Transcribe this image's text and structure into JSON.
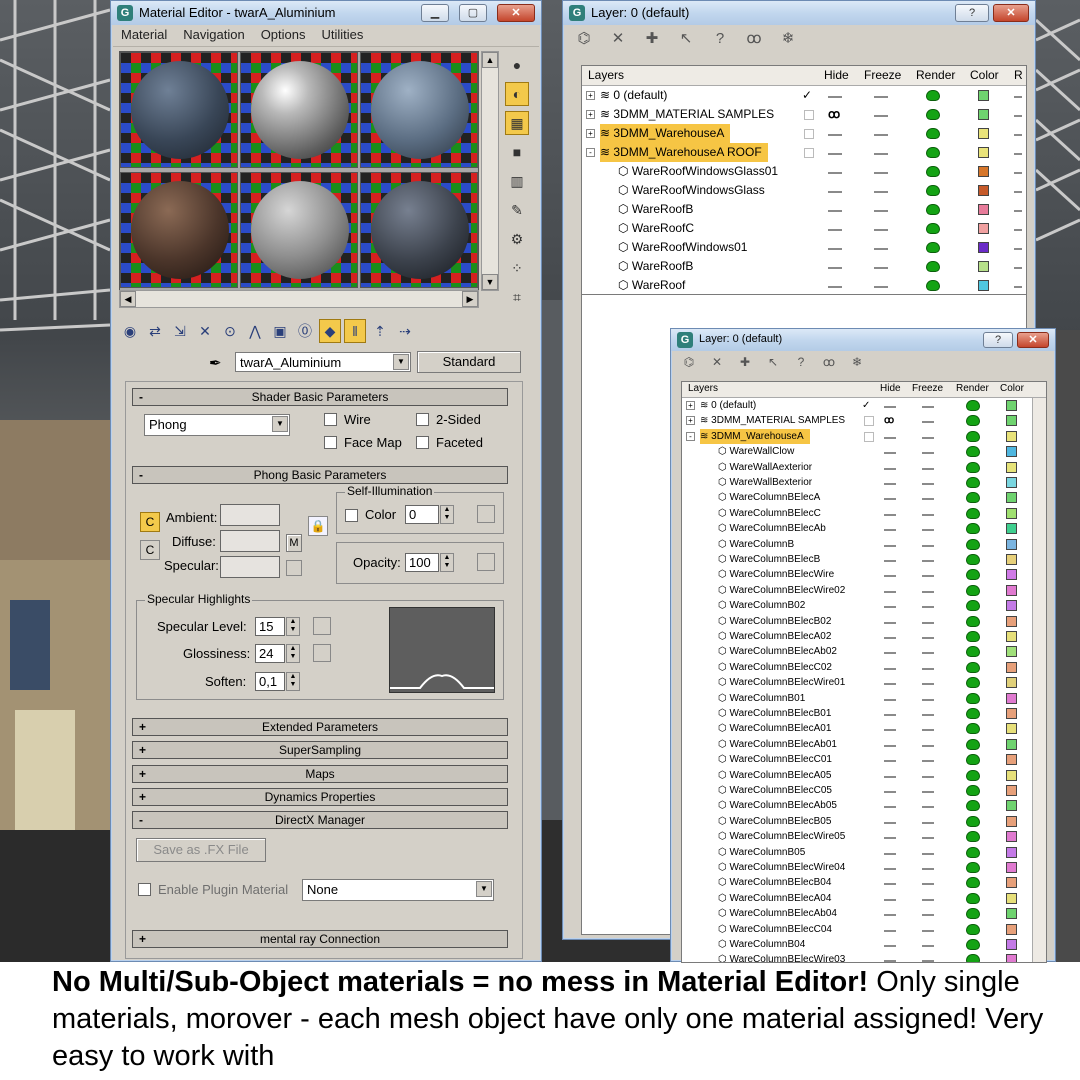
{
  "material_editor": {
    "title": "Material Editor - twarA_Aluminium",
    "menu": [
      "Material",
      "Navigation",
      "Options",
      "Utilities"
    ],
    "material_name": "twarA_Aluminium",
    "material_type": "Standard",
    "shader_rollout": "Shader Basic Parameters",
    "shader": "Phong",
    "wire_label": "Wire",
    "two_sided_label": "2-Sided",
    "face_map_label": "Face Map",
    "faceted_label": "Faceted",
    "phong_rollout": "Phong Basic Parameters",
    "self_illumination_label": "Self-Illumination",
    "ambient_label": "Ambient:",
    "diffuse_label": "Diffuse:",
    "specular_label": "Specular:",
    "m_label": "M",
    "color_label": "Color",
    "color_value": "0",
    "opacity_label": "Opacity:",
    "opacity_value": "100",
    "specular_highlights_label": "Specular Highlights",
    "specular_level_label": "Specular Level:",
    "specular_level_value": "15",
    "glossiness_label": "Glossiness:",
    "glossiness_value": "24",
    "soften_label": "Soften:",
    "soften_value": "0,1",
    "rollouts": [
      "Extended Parameters",
      "SuperSampling",
      "Maps",
      "Dynamics Properties",
      "DirectX Manager",
      "mental ray Connection"
    ],
    "save_fx_label": "Save as .FX File",
    "enable_plugin_label": "Enable Plugin Material",
    "plugin_value": "None"
  },
  "layer_window": {
    "title": "Layer: 0 (default)",
    "columns": [
      "Layers",
      "Hide",
      "Freeze",
      "Render",
      "Color",
      "R"
    ],
    "rows": [
      {
        "name": "0 (default)",
        "level": 0,
        "expand": "+",
        "active": true,
        "hidden": false,
        "highlight": false,
        "color": "#6fd36f"
      },
      {
        "name": "3DMM_MATERIAL SAMPLES",
        "level": 0,
        "expand": "+",
        "active": false,
        "hidden": true,
        "highlight": false,
        "color": "#6fd36f"
      },
      {
        "name": "3DMM_WarehouseA",
        "level": 0,
        "expand": "+",
        "active": false,
        "hidden": false,
        "highlight": true,
        "color": "#e9e37a"
      },
      {
        "name": "3DMM_WarehouseA ROOF",
        "level": 0,
        "expand": "-",
        "active": false,
        "hidden": false,
        "highlight": true,
        "color": "#e9e37a"
      },
      {
        "name": "WareRoofWindowsGlass01",
        "level": 1,
        "color": "#d6762a"
      },
      {
        "name": "WareRoofWindowsGlass",
        "level": 1,
        "color": "#c65a2a"
      },
      {
        "name": "WareRoofB",
        "level": 1,
        "color": "#e77b9a"
      },
      {
        "name": "WareRoofC",
        "level": 1,
        "color": "#f0a0a0"
      },
      {
        "name": "WareRoofWindows01",
        "level": 1,
        "color": "#6a2bc8"
      },
      {
        "name": "WareRoofB",
        "level": 1,
        "color": "#b7e08a"
      },
      {
        "name": "WareRoof",
        "level": 1,
        "color": "#4fc7e0"
      }
    ]
  },
  "layer_window2": {
    "title": "Layer: 0 (default)",
    "columns": [
      "Layers",
      "Hide",
      "Freeze",
      "Render",
      "Color"
    ],
    "rows": [
      {
        "name": "0 (default)",
        "level": 0,
        "expand": "+",
        "active": true,
        "hidden": false,
        "highlight": false,
        "color": "#6fd36f"
      },
      {
        "name": "3DMM_MATERIAL SAMPLES",
        "level": 0,
        "expand": "+",
        "active": false,
        "hidden": true,
        "highlight": false,
        "color": "#6fd36f"
      },
      {
        "name": "3DMM_WarehouseA",
        "level": 0,
        "expand": "-",
        "active": false,
        "hidden": false,
        "highlight": true,
        "color": "#e9e37a"
      },
      {
        "name": "WareWallClow",
        "level": 1,
        "color": "#4fb7e0"
      },
      {
        "name": "WareWallAexterior",
        "level": 1,
        "color": "#e7e47a"
      },
      {
        "name": "WareWallBexterior",
        "level": 1,
        "color": "#7ad6e0"
      },
      {
        "name": "WareColumnBElecA",
        "level": 1,
        "color": "#6fd36f"
      },
      {
        "name": "WareColumnBElecC",
        "level": 1,
        "color": "#a0e070"
      },
      {
        "name": "WareColumnBElecAb",
        "level": 1,
        "color": "#3fcf8f"
      },
      {
        "name": "WareColumnB",
        "level": 1,
        "color": "#7ab4e0"
      },
      {
        "name": "WareColumnBElecB",
        "level": 1,
        "color": "#e7d07a"
      },
      {
        "name": "WareColumnBElecWire",
        "level": 1,
        "color": "#d07ae7"
      },
      {
        "name": "WareColumnBElecWire02",
        "level": 1,
        "color": "#e07ad0"
      },
      {
        "name": "WareColumnB02",
        "level": 1,
        "color": "#c47ae7"
      },
      {
        "name": "WareColumnBElecB02",
        "level": 1,
        "color": "#e7a07a"
      },
      {
        "name": "WareColumnBElecA02",
        "level": 1,
        "color": "#e7e07a"
      },
      {
        "name": "WareColumnBElecAb02",
        "level": 1,
        "color": "#a0e07a"
      },
      {
        "name": "WareColumnBElecC02",
        "level": 1,
        "color": "#e7a07a"
      },
      {
        "name": "WareColumnBElecWire01",
        "level": 1,
        "color": "#e0d07a"
      },
      {
        "name": "WareColumnB01",
        "level": 1,
        "color": "#e07ad0"
      },
      {
        "name": "WareColumnBElecB01",
        "level": 1,
        "color": "#e7a07a"
      },
      {
        "name": "WareColumnBElecA01",
        "level": 1,
        "color": "#e7e07a"
      },
      {
        "name": "WareColumnBElecAb01",
        "level": 1,
        "color": "#6fd36f"
      },
      {
        "name": "WareColumnBElecC01",
        "level": 1,
        "color": "#e7a07a"
      },
      {
        "name": "WareColumnBElecA05",
        "level": 1,
        "color": "#e7e07a"
      },
      {
        "name": "WareColumnBElecC05",
        "level": 1,
        "color": "#e7a07a"
      },
      {
        "name": "WareColumnBElecAb05",
        "level": 1,
        "color": "#6fd36f"
      },
      {
        "name": "WareColumnBElecB05",
        "level": 1,
        "color": "#e7a07a"
      },
      {
        "name": "WareColumnBElecWire05",
        "level": 1,
        "color": "#e07ad0"
      },
      {
        "name": "WareColumnB05",
        "level": 1,
        "color": "#c47ae7"
      },
      {
        "name": "WareColumnBElecWire04",
        "level": 1,
        "color": "#e07ad0"
      },
      {
        "name": "WareColumnBElecB04",
        "level": 1,
        "color": "#e7a07a"
      },
      {
        "name": "WareColumnBElecA04",
        "level": 1,
        "color": "#e7e07a"
      },
      {
        "name": "WareColumnBElecAb04",
        "level": 1,
        "color": "#6fd36f"
      },
      {
        "name": "WareColumnBElecC04",
        "level": 1,
        "color": "#e7a07a"
      },
      {
        "name": "WareColumnB04",
        "level": 1,
        "color": "#c47ae7"
      },
      {
        "name": "WareColumnBElecWire03",
        "level": 1,
        "color": "#e07ad0"
      }
    ]
  },
  "caption": {
    "bold": "No Multi/Sub-Object materials = no mess in Material Editor!",
    "rest": " Only single materials, morover - each mesh object have only one material assigned! Very easy to work with"
  }
}
